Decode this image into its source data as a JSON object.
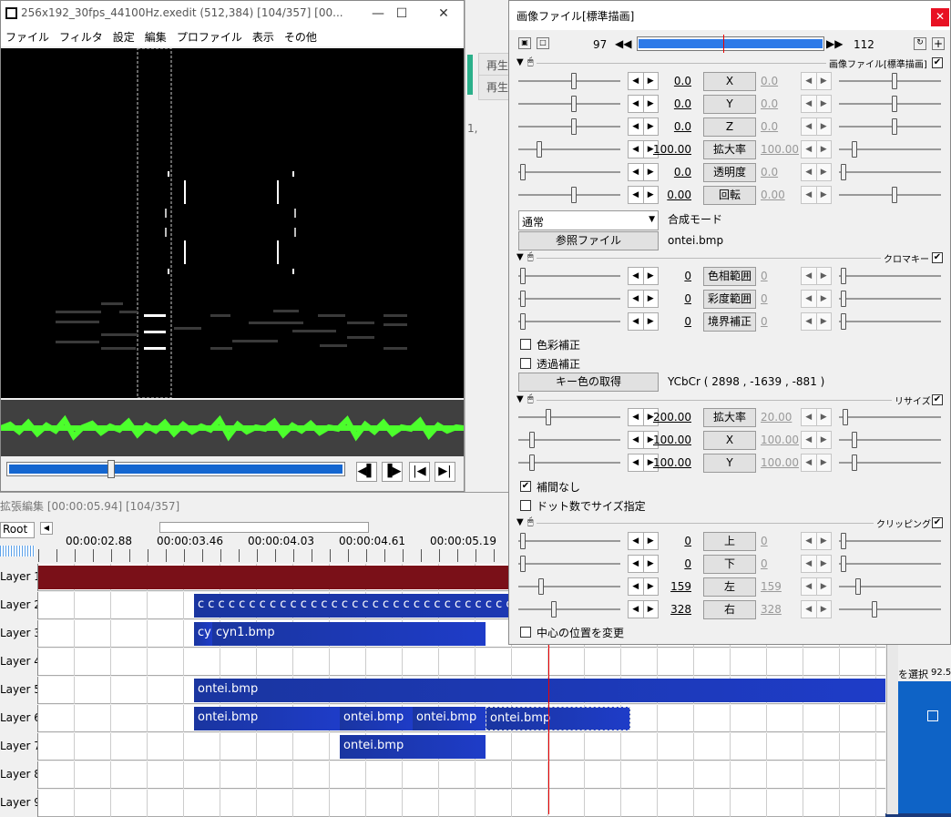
{
  "preview": {
    "title": "256x192_30fps_44100Hz.exedit (512,384)  [104/357] [00...",
    "menu": [
      "ファイル",
      "フィルタ",
      "設定",
      "編集",
      "プロファイル",
      "表示",
      "その他"
    ],
    "transport": [
      "◀▌",
      "▐▶",
      "|◀",
      "▶|"
    ]
  },
  "bg_window": {
    "btn1": "再生",
    "btn2": "再生",
    "num": "1,"
  },
  "timeline": {
    "title": "拡張編集 [00:00:05.94] [104/357]",
    "root": "Root",
    "ruler": [
      "00:00:02.88",
      "00:00:03.46",
      "00:00:04.03",
      "00:00:04.61",
      "00:00:05.19"
    ],
    "layers": [
      "Layer 1",
      "Layer 2",
      "Layer 3",
      "Layer 4",
      "Layer 5",
      "Layer 6",
      "Layer 7",
      "Layer 8",
      "Layer 9"
    ],
    "clips": {
      "l2": "c c c c c c c c c c c c c c c c c c c c c c c c c c c c c c c c c c c c c",
      "l3a": "cyn",
      "l3b": "cyn1.bmp",
      "l5": "ontei.bmp",
      "l6a": "ontei.bmp",
      "l6b": "ontei.bmp",
      "l6c": "ontei.bmp",
      "l6d": "ontei.bmp",
      "l7": "ontei.bmp"
    }
  },
  "dialog": {
    "title": "画像ファイル[標準描画]",
    "frame_start": "97",
    "frame_end": "112",
    "sec1_label": "画像ファイル[標準描画]",
    "params1": [
      {
        "label": "X",
        "val": "0.0",
        "val2": "0.0"
      },
      {
        "label": "Y",
        "val": "0.0",
        "val2": "0.0"
      },
      {
        "label": "Z",
        "val": "0.0",
        "val2": "0.0"
      },
      {
        "label": "拡大率",
        "val": "100.00",
        "val2": "100.00"
      },
      {
        "label": "透明度",
        "val": "0.0",
        "val2": "0.0"
      },
      {
        "label": "回転",
        "val": "0.00",
        "val2": "0.00"
      }
    ],
    "blend_select": "通常",
    "blend_label": "合成モード",
    "ref_file_btn": "参照ファイル",
    "ref_file_name": "ontei.bmp",
    "sec2_label": "クロマキー",
    "params2": [
      {
        "label": "色相範囲",
        "val": "0",
        "val2": "0"
      },
      {
        "label": "彩度範囲",
        "val": "0",
        "val2": "0"
      },
      {
        "label": "境界補正",
        "val": "0",
        "val2": "0"
      }
    ],
    "color_correct": "色彩補正",
    "transparent_correct": "透過補正",
    "key_color_btn": "キー色の取得",
    "ycbcr": "YCbCr ( 2898 , -1639 , -881 )",
    "sec3_label": "リサイズ",
    "params3": [
      {
        "label": "拡大率",
        "val": "200.00",
        "val2": "20.00"
      },
      {
        "label": "X",
        "val": "100.00",
        "val2": "100.00"
      },
      {
        "label": "Y",
        "val": "100.00",
        "val2": "100.00"
      }
    ],
    "no_interp": "補間なし",
    "dot_size": "ドット数でサイズ指定",
    "sec4_label": "クリッピング",
    "params4": [
      {
        "label": "上",
        "val": "0",
        "val2": "0"
      },
      {
        "label": "下",
        "val": "0",
        "val2": "0"
      },
      {
        "label": "左",
        "val": "159",
        "val2": "159"
      },
      {
        "label": "右",
        "val": "328",
        "val2": "328"
      }
    ],
    "center_change": "中心の位置を変更"
  },
  "right_bg": {
    "text1": "を選択",
    "text2": "92.5"
  }
}
